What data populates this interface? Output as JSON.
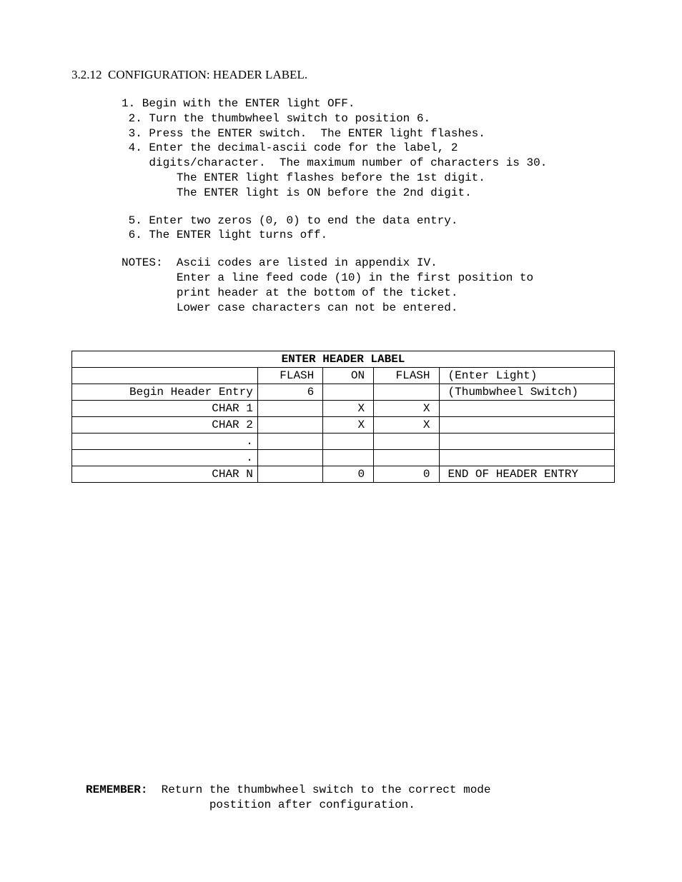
{
  "heading": {
    "number": "3.2.12",
    "title": "CONFIGURATION:   HEADER LABEL."
  },
  "steps_block1": "1. Begin with the ENTER light OFF.\n 2. Turn the thumbwheel switch to position 6.\n 3. Press the ENTER switch.  The ENTER light flashes.\n 4. Enter the decimal-ascii code for the label, 2\n    digits/character.  The maximum number of characters is 30.\n        The ENTER light flashes before the 1st digit.\n        The ENTER light is ON before the 2nd digit.",
  "steps_block2": " 5. Enter two zeros (0, 0) to end the data entry.\n 6. The ENTER light turns off.",
  "notes_block": "NOTES:  Ascii codes are listed in appendix IV.\n        Enter a line feed code (10) in the first position to\n        print header at the bottom of the ticket.\n        Lower case characters can not be entered.",
  "table": {
    "title": "ENTER HEADER LABEL",
    "header": {
      "label": "",
      "flash": "FLASH",
      "on": "ON",
      "flash2": "FLASH",
      "note": "(Enter Light)"
    },
    "rows": [
      {
        "label": "Begin Header Entry",
        "flash": "6",
        "on": "",
        "flash2": "",
        "note": "(Thumbwheel Switch)"
      },
      {
        "label": "CHAR 1",
        "flash": "",
        "on": "X",
        "flash2": "X",
        "note": ""
      },
      {
        "label": "CHAR 2",
        "flash": "",
        "on": "X",
        "flash2": "X",
        "note": ""
      },
      {
        "label": ".",
        "flash": "",
        "on": "",
        "flash2": "",
        "note": ""
      },
      {
        "label": ".",
        "flash": "",
        "on": "",
        "flash2": "",
        "note": ""
      },
      {
        "label": "CHAR N",
        "flash": "",
        "on": "0",
        "flash2": "0",
        "note": "END OF HEADER ENTRY"
      }
    ]
  },
  "remember": {
    "label": "REMEMBER:",
    "text": "  Return the thumbwheel switch to the correct mode\n                  postition after configuration."
  }
}
